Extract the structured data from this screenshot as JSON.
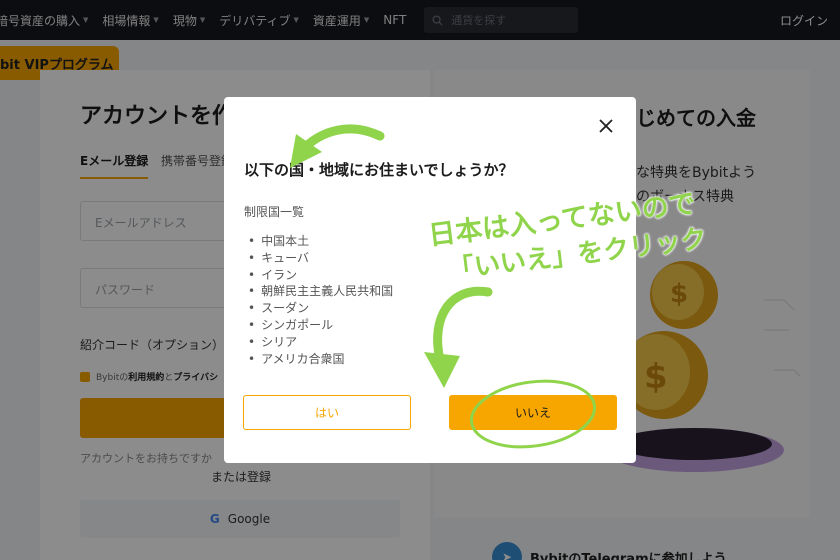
{
  "nav": {
    "items": [
      "暗号資産の購入",
      "相場情報",
      "現物",
      "デリバティブ",
      "資産運用",
      "NFT"
    ],
    "search_placeholder": "通貨を探す",
    "login": "ログイン"
  },
  "vip_badge": "bit VIPプログラム",
  "background": {
    "title": "アカウントを作",
    "tab_email": "Eメール登録",
    "tab_phone": "携帯番号登録",
    "email_placeholder": "Eメールアドレス",
    "password_placeholder": "パスワード",
    "referral_label": "紹介コード（オプション）",
    "terms_prefix": "Bybitの",
    "terms_link1": "利用規約",
    "terms_and": "と",
    "terms_link2": "プライバシ",
    "have_account": "アカウントをお持ちですか",
    "or_register": "または登録",
    "google_label": "Google",
    "right_title": "じめての入金",
    "right_line1": "な特典をBybitよう",
    "right_line2": "のボーナス特典",
    "telegram": "BybitのTelegramに参加しよう"
  },
  "modal": {
    "title": "以下の国・地域にお住まいでしょうか？",
    "list_heading": "制限国一覧",
    "countries": [
      "中国本土",
      "キューバ",
      "イラン",
      "朝鮮民主主義人民共和国",
      "スーダン",
      "シンガポール",
      "シリア",
      "アメリカ合衆国"
    ],
    "yes_button": "はい",
    "no_button": "いいえ"
  },
  "annotation": {
    "line1": "日本は入ってないので",
    "line2": "「いいえ」をクリック"
  },
  "colors": {
    "accent": "#f7a600",
    "annotation": "#8fd44b",
    "nav_bg": "#17181e"
  }
}
